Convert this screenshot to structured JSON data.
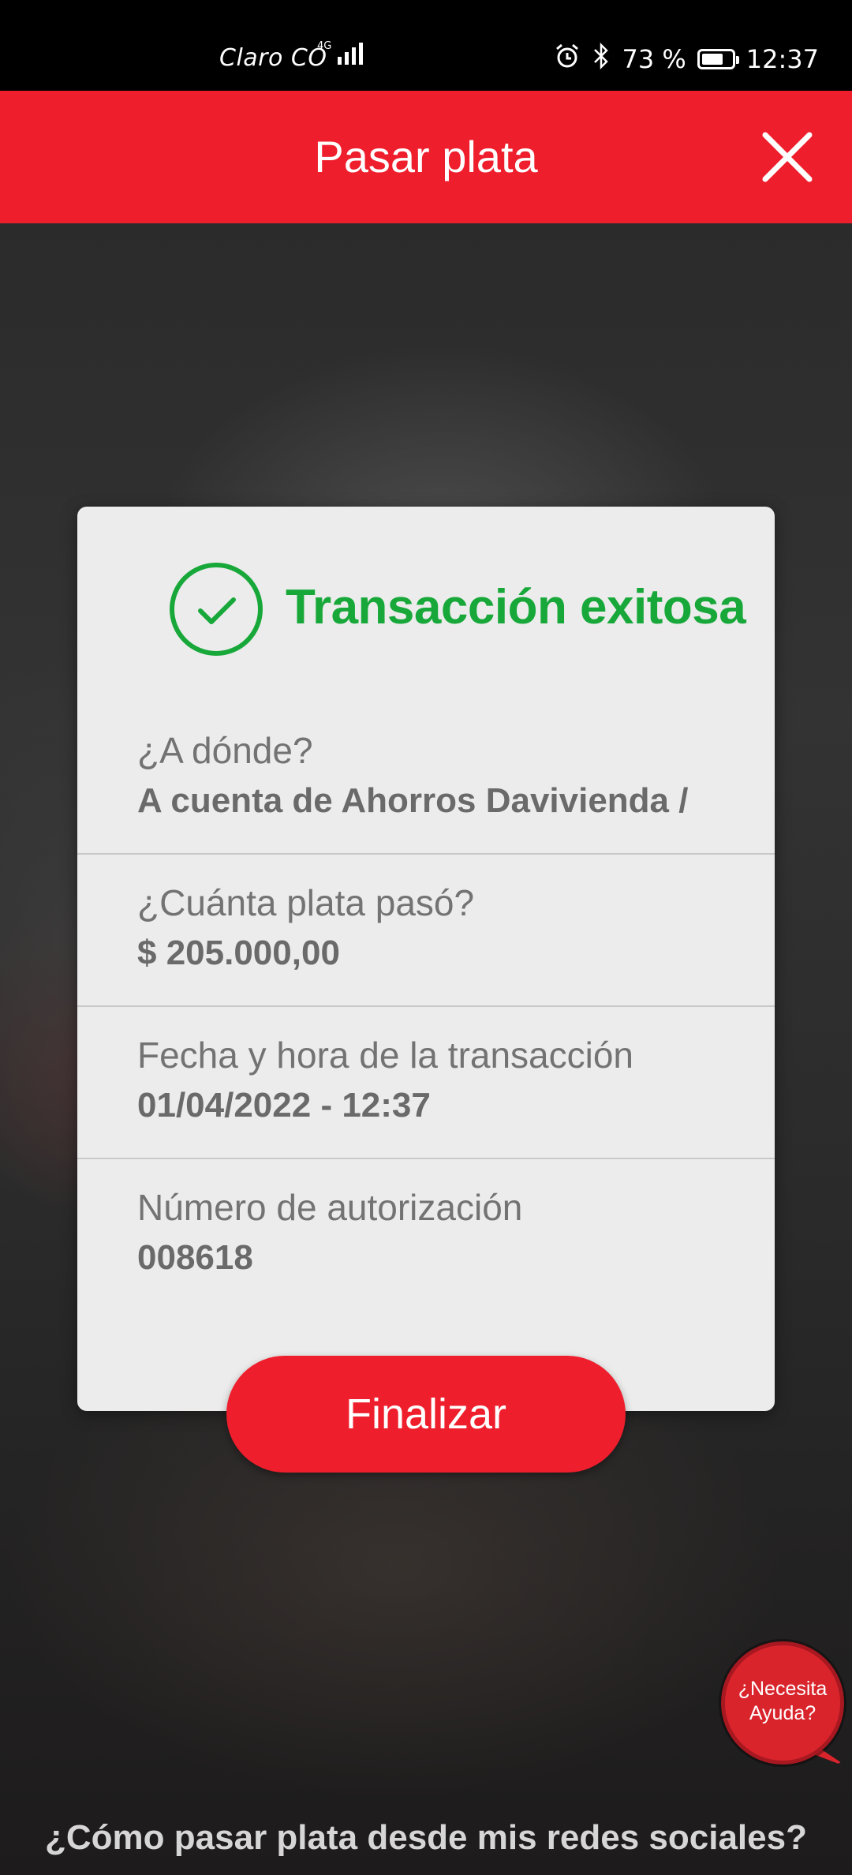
{
  "status_bar": {
    "carrier": "Claro CO",
    "network": "4G",
    "battery": "73 %",
    "battery_level": 0.73,
    "time": "12:37"
  },
  "header": {
    "title": "Pasar plata",
    "close_icon": "close-icon"
  },
  "card": {
    "status": "Transacción exitosa",
    "status_icon": "check-circle-icon",
    "status_color": "#18a83a",
    "items": [
      {
        "label": "¿A dónde?",
        "value": "A cuenta de Ahorros Davivienda /"
      },
      {
        "label": "¿Cuánta plata pasó?",
        "value": "$ 205.000,00"
      },
      {
        "label": "Fecha y hora de la transacción",
        "value": "01/04/2022 - 12:37"
      },
      {
        "label": "Número de autorización",
        "value": "008618"
      }
    ]
  },
  "finalize_button": "Finalizar",
  "help": {
    "line1": "¿Necesita",
    "line2": "Ayuda?"
  },
  "social_link": "¿Cómo pasar plata desde mis redes sociales?",
  "colors": {
    "brand_red": "#ef1e2c",
    "success_green": "#18a83a"
  }
}
